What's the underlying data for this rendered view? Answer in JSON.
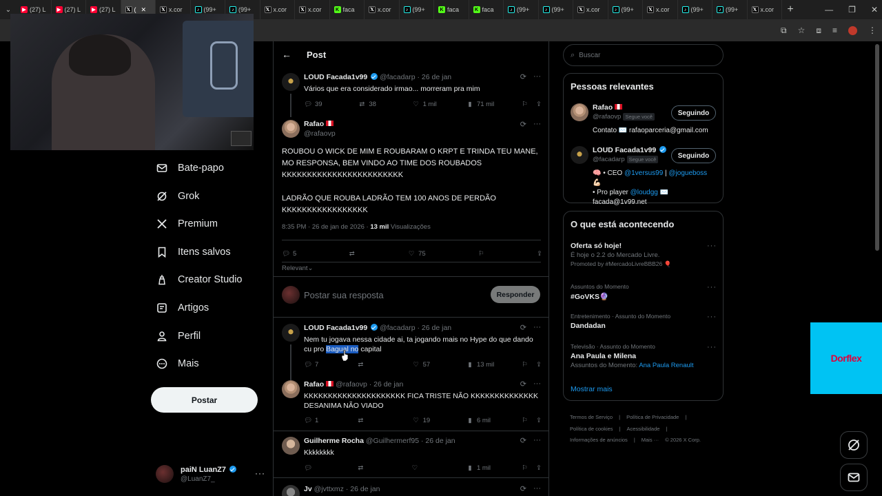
{
  "browser": {
    "tabs": [
      {
        "icon": "youtube",
        "label": "(27) L"
      },
      {
        "icon": "youtube",
        "label": "(27) L"
      },
      {
        "icon": "youtube",
        "label": "(27) L"
      },
      {
        "icon": "x",
        "label": "(",
        "active": true
      },
      {
        "icon": "x",
        "label": "x.cor"
      },
      {
        "icon": "tiktok",
        "label": "(99+"
      },
      {
        "icon": "tiktok",
        "label": "(99+"
      },
      {
        "icon": "x",
        "label": "x.cor"
      },
      {
        "icon": "x",
        "label": "x.cor"
      },
      {
        "icon": "kick",
        "label": "faca"
      },
      {
        "icon": "x",
        "label": "x.cor"
      },
      {
        "icon": "tiktok",
        "label": "(99+"
      },
      {
        "icon": "kick",
        "label": "faca"
      },
      {
        "icon": "kick",
        "label": "faca"
      },
      {
        "icon": "tiktok",
        "label": "(99+"
      },
      {
        "icon": "tiktok",
        "label": "(99+"
      },
      {
        "icon": "x",
        "label": "x.cor"
      },
      {
        "icon": "tiktok",
        "label": "(99+"
      },
      {
        "icon": "x",
        "label": "x.cor"
      },
      {
        "icon": "tiktok",
        "label": "(99+"
      },
      {
        "icon": "tiktok",
        "label": "(99+"
      },
      {
        "icon": "x",
        "label": "x.cor"
      }
    ]
  },
  "nav": {
    "items": [
      {
        "icon": "mail-icon",
        "label": "Bate-papo"
      },
      {
        "icon": "grok-icon",
        "label": "Grok"
      },
      {
        "icon": "x-logo-icon",
        "label": "Premium"
      },
      {
        "icon": "bookmark-icon",
        "label": "Itens salvos"
      },
      {
        "icon": "creator-studio-icon",
        "label": "Creator Studio"
      },
      {
        "icon": "article-icon",
        "label": "Artigos"
      },
      {
        "icon": "person-icon",
        "label": "Perfil"
      },
      {
        "icon": "more-circle-icon",
        "label": "Mais"
      }
    ],
    "post_button": "Postar",
    "account": {
      "name": "paiN LuanZ7",
      "handle": "@LuanZ7_"
    }
  },
  "header": {
    "title": "Post"
  },
  "parent_tweet": {
    "name": "LOUD Facada1v99",
    "meta": "@facadarp · 26 de jan",
    "text": "Vários que era considerado irmao... morreram pra mim",
    "replies": "39",
    "reposts": "38",
    "likes": "1 mil",
    "views": "71 mil"
  },
  "focus_tweet": {
    "name": "Rafao",
    "handle": "@rafaovp",
    "text1": "ROUBOU O WICK DE MIM E ROUBARAM O KRPT E TRINDA TEU MANE, MO RESPONSA, BEM VINDO AO TIME DOS ROUBADOS KKKKKKKKKKKKKKKKKKKKKKKK",
    "text2": "LADRÃO QUE ROUBA LADRÃO TEM 100 ANOS DE PERDÃO KKKKKKKKKKKKKKKKK",
    "time": "8:35 PM · 26 de jan de 2026 ·",
    "views_count": "13 mil",
    "views_label": "Visualizações",
    "replies": "5",
    "likes": "75"
  },
  "sort_label": "Relevant",
  "reply_box": {
    "placeholder": "Postar sua resposta",
    "button": "Responder"
  },
  "replies": [
    {
      "name": "LOUD Facada1v99",
      "meta": "@facadarp · 26 de jan",
      "text_before": "Nem tu jogava nessa cidade ai, ta jogando mais no Hype do que dando cu pro ",
      "text_highlight": "Bagual no",
      "text_after": " capital",
      "replies": "7",
      "likes": "57",
      "views": "13 mil"
    },
    {
      "name": "Rafao",
      "meta": "@rafaovp · 26 de jan",
      "text": "KKKKKKKKKKKKKKKKKKKKK FICA TRISTE NÃO KKKKKKKKKKKKKK DESANIMA NÃO VIADO",
      "replies": "1",
      "likes": "19",
      "views": "6 mil"
    },
    {
      "name": "Guilherme Rocha",
      "meta": "@Guilhermerf95 · 26 de jan",
      "text": "Kkkkkkkk",
      "views": "1 mil"
    },
    {
      "name": "Jv",
      "meta": "@jvttxmz · 26 de jan"
    }
  ],
  "search": {
    "placeholder": "Buscar"
  },
  "relevant_people": {
    "title": "Pessoas relevantes",
    "people": [
      {
        "name": "Rafao",
        "handle": "@rafaovp",
        "badge": "Segue você",
        "bio": "Contato ✉️ rafaoparceria@gmail.com",
        "button": "Seguindo"
      },
      {
        "name": "LOUD Facada1v99",
        "handle": "@facadarp",
        "badge": "Segue você",
        "bio_a": "🧠 • CEO ",
        "bio_link1": "@1versus99",
        "bio_b": " | ",
        "bio_link2": "@jogueboss",
        "bio_c": " 💪🏻",
        "bio_d": "• Pro player ",
        "bio_link3": "@loudgg",
        "bio_e": " ✉️",
        "bio_f": "facada@1v99.net",
        "button": "Seguindo"
      }
    ]
  },
  "trends": {
    "title": "O que está acontecendo",
    "items": [
      {
        "category": "",
        "title": "Oferta só hoje!",
        "subtitle": "É hoje o 2.2 do Mercado Livre.",
        "promoted": "Promoted by #MercadoLivreBBB26 🎈"
      },
      {
        "category": "Assuntos do Momento",
        "title": "#GoVKS🔮"
      },
      {
        "category": "Entretenimento · Assunto do Momento",
        "title": "Dandadan"
      },
      {
        "category": "Televisão · Assunto do Momento",
        "title": "Ana Paula e Milena",
        "sub_label": "Assuntos do Momento: ",
        "sub_link": "Ana Paula Renault"
      }
    ],
    "show_more": "Mostrar mais"
  },
  "footer": {
    "links": [
      "Termos de Serviço",
      "|",
      "Política de Privacidade",
      "|",
      "Política de cookies",
      "|",
      "Acessibilidade",
      "|",
      "Informações de anúncios",
      "|",
      "Mais ···",
      "© 2026 X Corp."
    ]
  },
  "ad": {
    "brand": "Dorflex"
  }
}
